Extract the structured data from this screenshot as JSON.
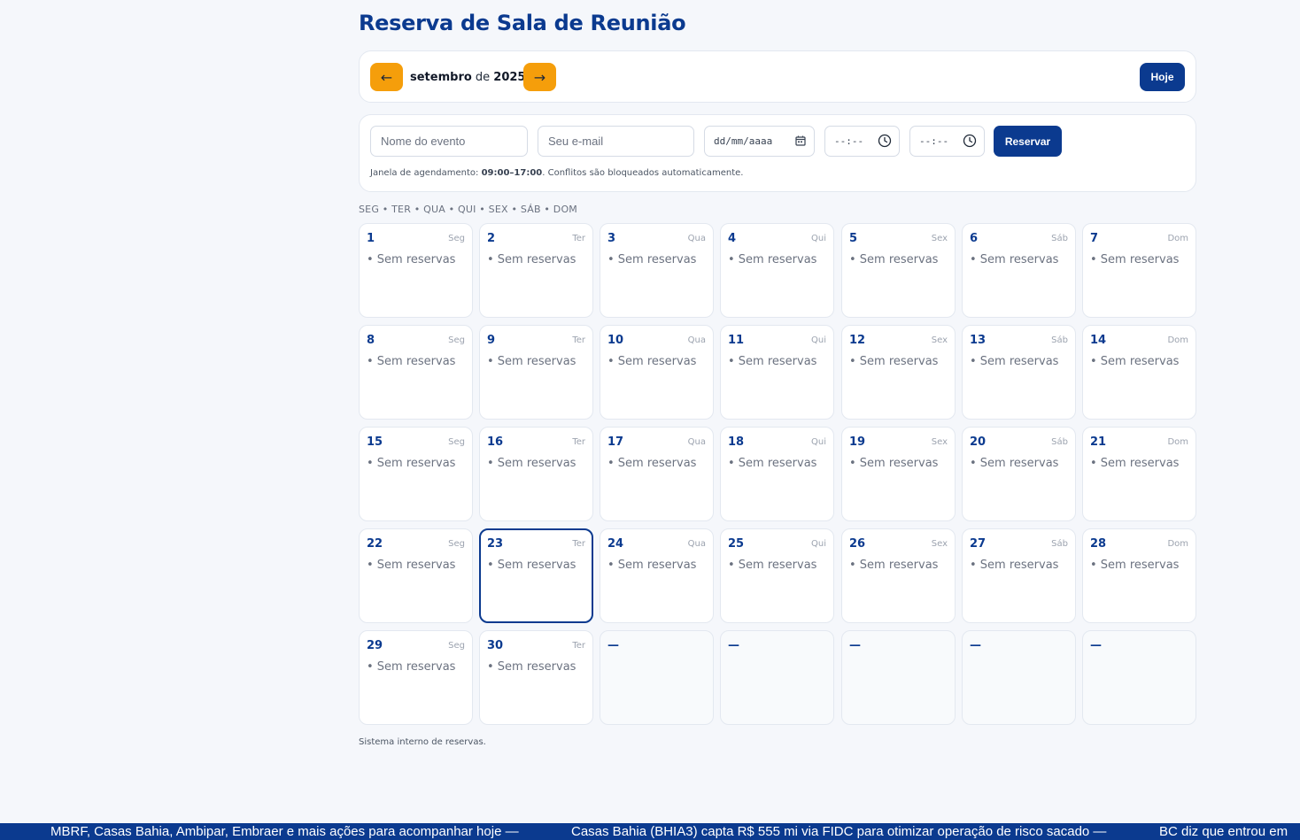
{
  "page": {
    "title": "Reserva de Sala de Reunião"
  },
  "nav": {
    "prev_label": "←",
    "next_label": "→",
    "month": "setembro",
    "connector": " de ",
    "year": "2025",
    "today_label": "Hoje"
  },
  "form": {
    "event_placeholder": "Nome do evento",
    "email_placeholder": "Seu e-mail",
    "date_value": "dd/mm/aaaa",
    "start_time_value": "--:--",
    "end_time_value": "--:--",
    "submit_label": "Reservar",
    "hint_prefix": "Janela de agendamento: ",
    "hint_window": "09:00–17:00",
    "hint_suffix": ". Conflitos são bloqueados automaticamente."
  },
  "weekdays_header": "SEG • TER • QUA • QUI • SEX • SÁB • DOM",
  "calendar": {
    "empty_text": "• Sem reservas",
    "placeholder": "—",
    "today_day": 23,
    "days": [
      {
        "day": "1",
        "weekday": "Seg"
      },
      {
        "day": "2",
        "weekday": "Ter"
      },
      {
        "day": "3",
        "weekday": "Qua"
      },
      {
        "day": "4",
        "weekday": "Qui"
      },
      {
        "day": "5",
        "weekday": "Sex"
      },
      {
        "day": "6",
        "weekday": "Sáb"
      },
      {
        "day": "7",
        "weekday": "Dom"
      },
      {
        "day": "8",
        "weekday": "Seg"
      },
      {
        "day": "9",
        "weekday": "Ter"
      },
      {
        "day": "10",
        "weekday": "Qua"
      },
      {
        "day": "11",
        "weekday": "Qui"
      },
      {
        "day": "12",
        "weekday": "Sex"
      },
      {
        "day": "13",
        "weekday": "Sáb"
      },
      {
        "day": "14",
        "weekday": "Dom"
      },
      {
        "day": "15",
        "weekday": "Seg"
      },
      {
        "day": "16",
        "weekday": "Ter"
      },
      {
        "day": "17",
        "weekday": "Qua"
      },
      {
        "day": "18",
        "weekday": "Qui"
      },
      {
        "day": "19",
        "weekday": "Sex"
      },
      {
        "day": "20",
        "weekday": "Sáb"
      },
      {
        "day": "21",
        "weekday": "Dom"
      },
      {
        "day": "22",
        "weekday": "Seg"
      },
      {
        "day": "23",
        "weekday": "Ter"
      },
      {
        "day": "24",
        "weekday": "Qua"
      },
      {
        "day": "25",
        "weekday": "Qui"
      },
      {
        "day": "26",
        "weekday": "Sex"
      },
      {
        "day": "27",
        "weekday": "Sáb"
      },
      {
        "day": "28",
        "weekday": "Dom"
      },
      {
        "day": "29",
        "weekday": "Seg"
      },
      {
        "day": "30",
        "weekday": "Ter"
      }
    ],
    "trailing_empty": 5
  },
  "footer_note": "Sistema interno de reservas.",
  "ticker": {
    "items": [
      "MBRF, Casas Bahia, Ambipar, Embraer e mais ações para acompanhar hoje —",
      "Casas Bahia (BHIA3) capta R$ 555 mi via FIDC para otimizar operação de risco sacado —",
      "BC diz que entrou em"
    ]
  },
  "colors": {
    "primary": "#0b3a8f",
    "accent": "#f59e0b",
    "background": "#f5f7fb"
  },
  "icons": {
    "date": "calendar-icon",
    "time": "clock-icon"
  }
}
